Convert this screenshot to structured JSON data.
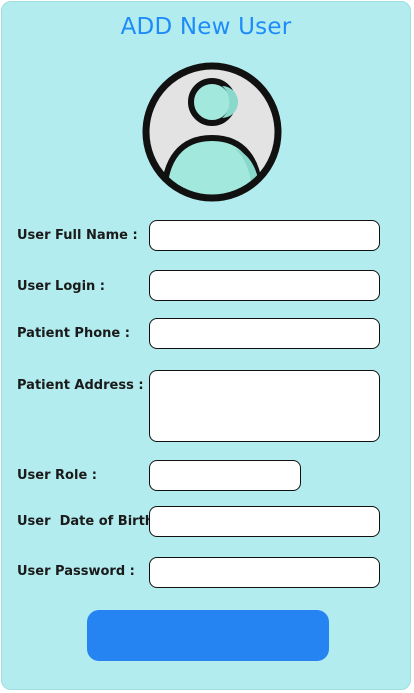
{
  "form": {
    "title": "ADD New User",
    "fields": [
      {
        "label": "User Full Name :",
        "value": "",
        "placeholder": ""
      },
      {
        "label": "User Login :",
        "value": "",
        "placeholder": ""
      },
      {
        "label": "Patient Phone :",
        "value": "",
        "placeholder": ""
      },
      {
        "label": "Patient Address :",
        "value": "",
        "placeholder": ""
      },
      {
        "label": "User Role :",
        "value": "",
        "placeholder": ""
      },
      {
        "label": "User  Date of Birth :",
        "value": "",
        "placeholder": ""
      },
      {
        "label": "User Password :",
        "value": "",
        "placeholder": ""
      }
    ],
    "submit_label": ""
  },
  "avatar": {
    "icon": "user-avatar-icon",
    "colors": {
      "circle": "#e3e3e3",
      "shadow": "#cfcfcf",
      "figure": "#a3e8dc",
      "figure_shade": "#88d8cb",
      "outline": "#111111"
    }
  },
  "theme": {
    "card_bg": "#b3ecef",
    "title_color": "#1d8cf8",
    "button_bg": "#2684f2"
  }
}
